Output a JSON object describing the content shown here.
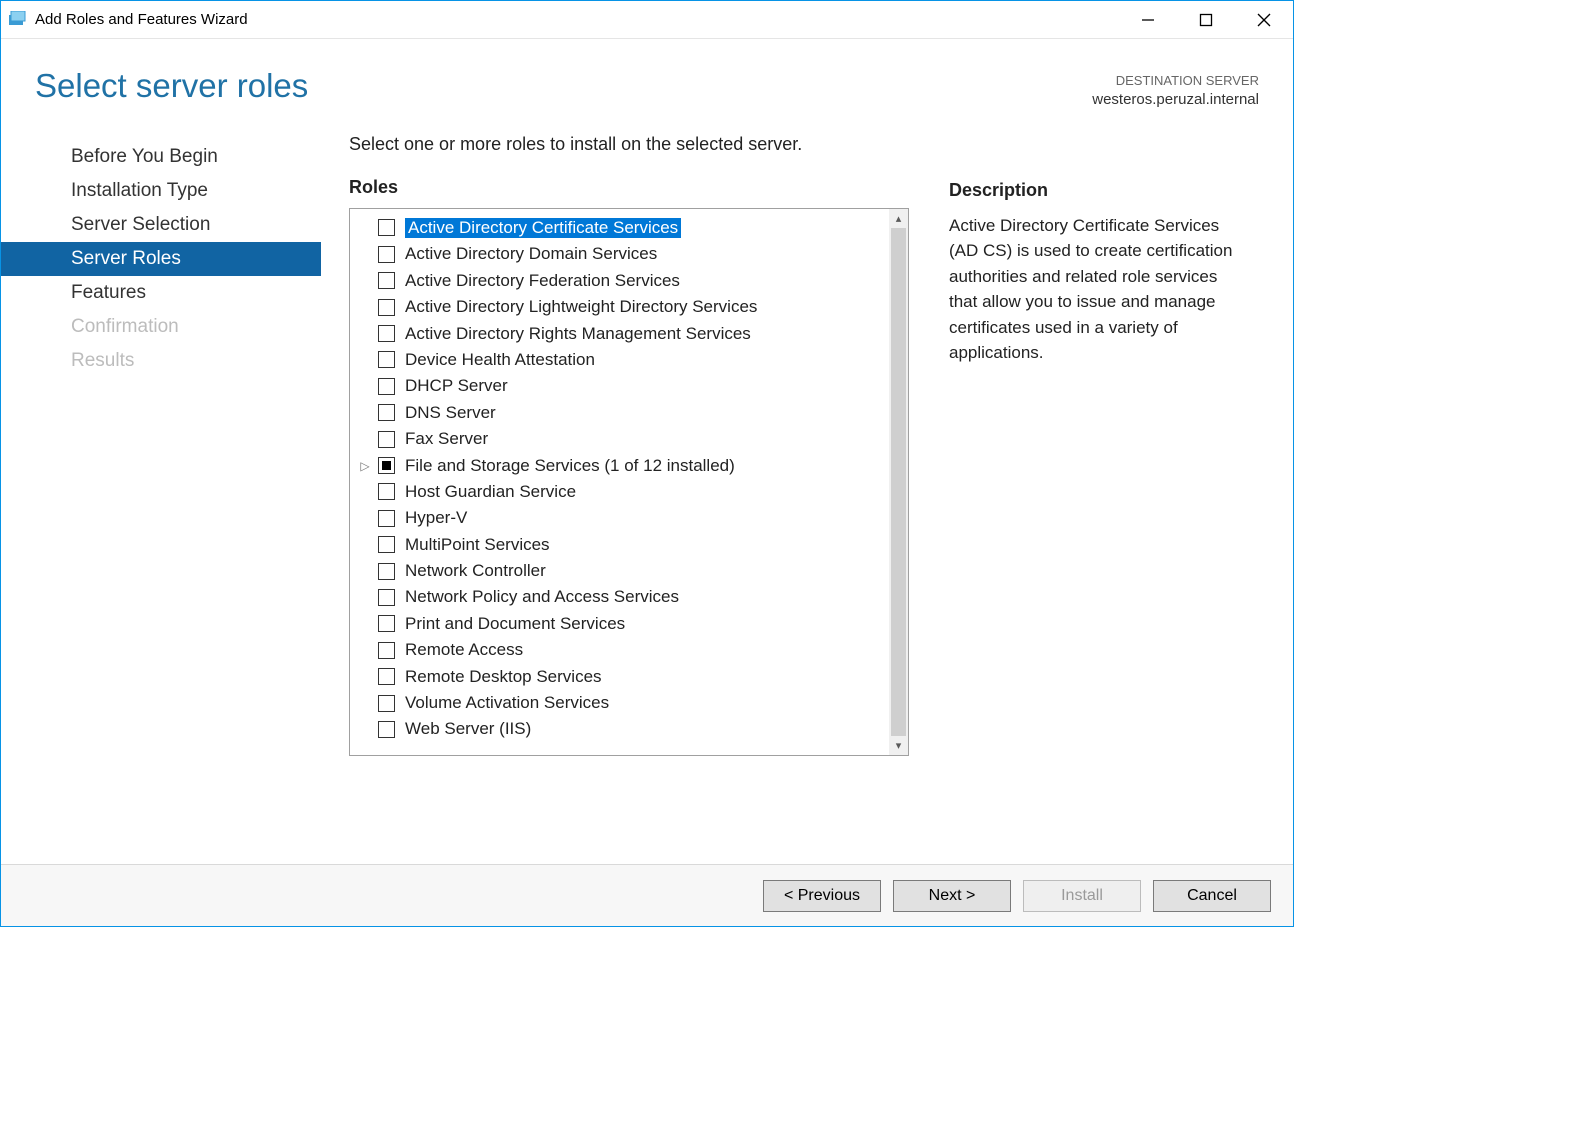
{
  "window": {
    "title": "Add Roles and Features Wizard"
  },
  "header": {
    "page_title": "Select server roles",
    "dest_label": "DESTINATION SERVER",
    "dest_server": "westeros.peruzal.internal"
  },
  "nav": {
    "items": [
      {
        "label": "Before You Begin",
        "state": "normal"
      },
      {
        "label": "Installation Type",
        "state": "normal"
      },
      {
        "label": "Server Selection",
        "state": "normal"
      },
      {
        "label": "Server Roles",
        "state": "selected"
      },
      {
        "label": "Features",
        "state": "normal"
      },
      {
        "label": "Confirmation",
        "state": "disabled"
      },
      {
        "label": "Results",
        "state": "disabled"
      }
    ]
  },
  "main": {
    "instruction": "Select one or more roles to install on the selected server.",
    "roles_label": "Roles",
    "roles": [
      {
        "label": "Active Directory Certificate Services",
        "checked": false,
        "highlighted": true
      },
      {
        "label": "Active Directory Domain Services",
        "checked": false
      },
      {
        "label": "Active Directory Federation Services",
        "checked": false
      },
      {
        "label": "Active Directory Lightweight Directory Services",
        "checked": false
      },
      {
        "label": "Active Directory Rights Management Services",
        "checked": false
      },
      {
        "label": "Device Health Attestation",
        "checked": false
      },
      {
        "label": "DHCP Server",
        "checked": false
      },
      {
        "label": "DNS Server",
        "checked": false
      },
      {
        "label": "Fax Server",
        "checked": false
      },
      {
        "label": "File and Storage Services (1 of 12 installed)",
        "checked": "partial",
        "expandable": true
      },
      {
        "label": "Host Guardian Service",
        "checked": false
      },
      {
        "label": "Hyper-V",
        "checked": false
      },
      {
        "label": "MultiPoint Services",
        "checked": false
      },
      {
        "label": "Network Controller",
        "checked": false
      },
      {
        "label": "Network Policy and Access Services",
        "checked": false
      },
      {
        "label": "Print and Document Services",
        "checked": false
      },
      {
        "label": "Remote Access",
        "checked": false
      },
      {
        "label": "Remote Desktop Services",
        "checked": false
      },
      {
        "label": "Volume Activation Services",
        "checked": false
      },
      {
        "label": "Web Server (IIS)",
        "checked": false
      }
    ],
    "description_label": "Description",
    "description_text": "Active Directory Certificate Services (AD CS) is used to create certification authorities and related role services that allow you to issue and manage certificates used in a variety of applications."
  },
  "footer": {
    "previous": "< Previous",
    "next": "Next >",
    "install": "Install",
    "cancel": "Cancel"
  }
}
